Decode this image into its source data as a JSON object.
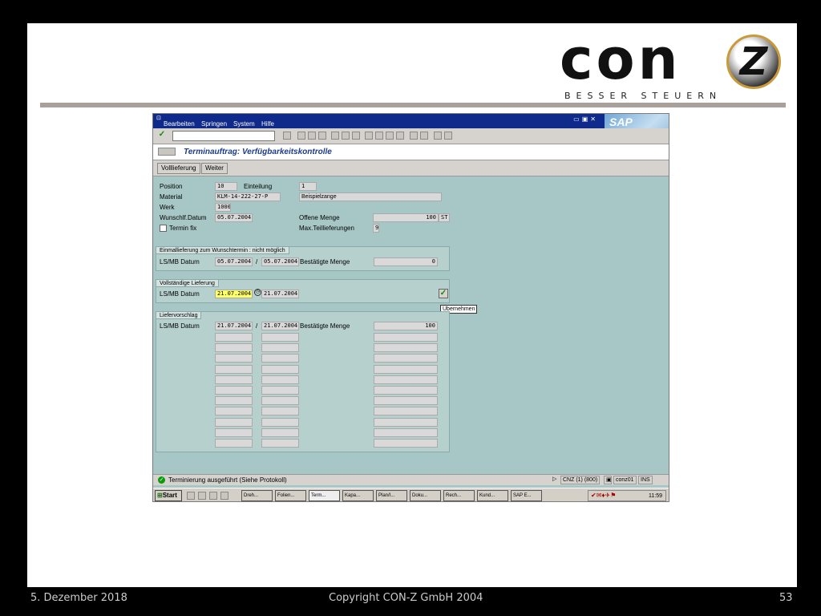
{
  "slide": {
    "logo_word": "con",
    "logo_mark": "Z",
    "logo_tagline": "BESSER STEUERN"
  },
  "footer": {
    "date": "5. Dezember 2018",
    "copyright": "Copyright CON-Z GmbH 2004",
    "page": "53"
  },
  "sap": {
    "menu": [
      "Bearbeiten",
      "Springen",
      "System",
      "Hilfe"
    ],
    "logo": "SAP",
    "screen_title": "Terminauftrag: Verfügbarkeitskontrolle",
    "app_buttons": {
      "full_delivery": "Volllieferung",
      "next": "Weiter"
    },
    "header": {
      "position_label": "Position",
      "position_value": "10",
      "schedule_label": "Einteilung",
      "schedule_value": "1",
      "material_label": "Material",
      "material_value": "KLM-14-222-27-P",
      "material_desc": "Beispielzange",
      "plant_label": "Werk",
      "plant_value": "1000",
      "wish_date_label": "Wunschlf.Datum",
      "wish_date_value": "05.07.2004",
      "open_qty_label": "Offene Menge",
      "open_qty_value": "100",
      "open_qty_unit": "ST",
      "fixed_date_label": "Termin fix",
      "max_partial_label": "Max.Teillieferungen",
      "max_partial_value": "9"
    },
    "group_single": {
      "title": "Einmallieferung zum Wunschtermin : nicht möglich",
      "date_label": "LS/MB Datum",
      "date1": "05.07.2004",
      "sep": "/",
      "date2": "05.07.2004",
      "confirmed_label": "Bestätigte Menge",
      "confirmed_value": "0"
    },
    "group_complete": {
      "title": "Vollständige Lieferung",
      "date_label": "LS/MB Datum",
      "date1": "21.07.2004",
      "date2": "21.07.2004",
      "tooltip": "Übernehmen"
    },
    "group_proposal": {
      "title": "Liefervorschlag",
      "date_label": "LS/MB Datum",
      "date1": "21.07.2004",
      "sep": "/",
      "date2": "21.07.2004",
      "confirmed_label": "Bestätigte Menge",
      "confirmed_value": "100"
    },
    "status": {
      "message": "Terminierung ausgeführt (Siehe Protokoll)",
      "system": "CNZ (1) (800)",
      "user": "conz01",
      "mode": "INS"
    },
    "taskbar": {
      "start": "Start",
      "tasks": [
        "Dreh...",
        "Folien...",
        "Term...",
        "Kapa...",
        "Plan/I...",
        "Doku...",
        "Rech...",
        "Kund...",
        "SAP E..."
      ],
      "clock": "11:59"
    }
  }
}
